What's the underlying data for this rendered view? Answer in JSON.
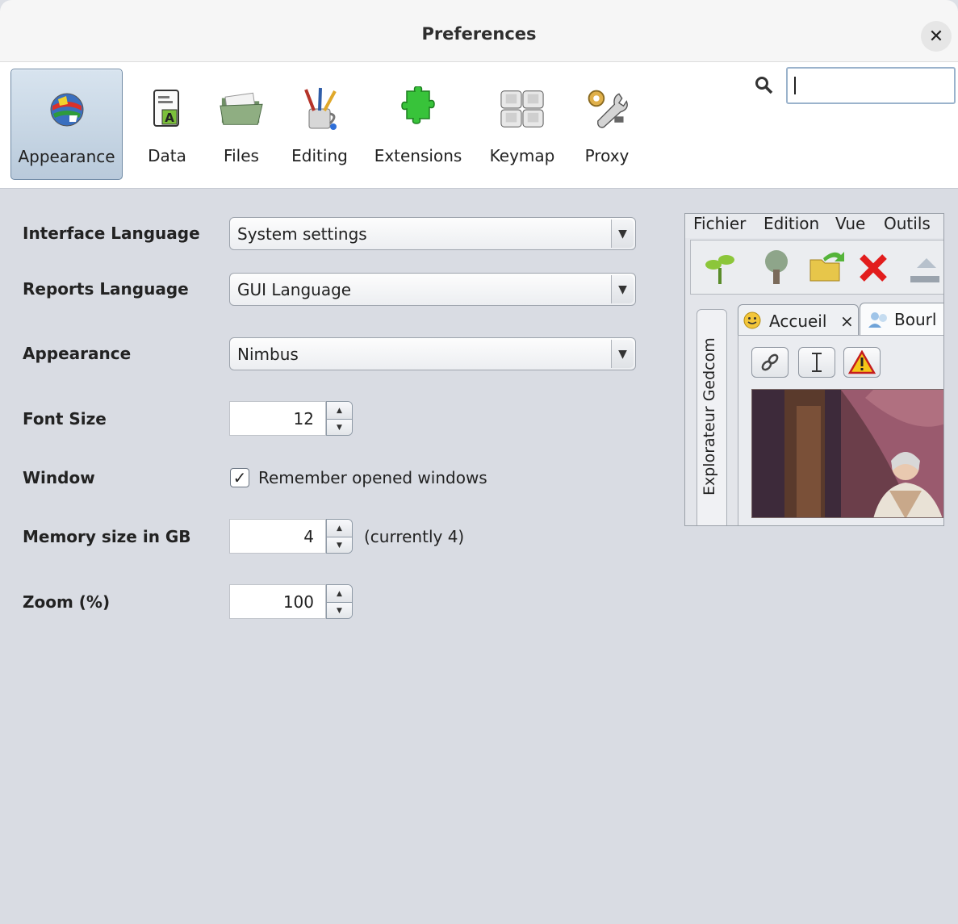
{
  "window": {
    "title": "Preferences"
  },
  "toolbar": {
    "tabs": [
      {
        "label": "Appearance",
        "icon": "globe-flags-icon",
        "active": true
      },
      {
        "label": "Data",
        "icon": "data-document-icon",
        "active": false
      },
      {
        "label": "Files",
        "icon": "folder-icon",
        "active": false
      },
      {
        "label": "Editing",
        "icon": "brushes-cup-icon",
        "active": false
      },
      {
        "label": "Extensions",
        "icon": "puzzle-piece-icon",
        "active": false
      },
      {
        "label": "Keymap",
        "icon": "keyboard-keys-icon",
        "active": false
      },
      {
        "label": "Proxy",
        "icon": "gear-wrench-icon",
        "active": false
      }
    ],
    "search": {
      "value": "",
      "icon": "search-icon"
    }
  },
  "form": {
    "interface_language": {
      "label": "Interface Language",
      "value": "System settings"
    },
    "reports_language": {
      "label": "Reports Language",
      "value": "GUI Language"
    },
    "appearance": {
      "label": "Appearance",
      "value": "Nimbus"
    },
    "font_size": {
      "label": "Font Size",
      "value": "12"
    },
    "window": {
      "label": "Window",
      "checkbox_label": "Remember opened windows",
      "checked": true
    },
    "memory": {
      "label": "Memory size in GB",
      "value": "4",
      "note": "(currently 4)"
    },
    "zoom": {
      "label": "Zoom (%)",
      "value": "100"
    }
  },
  "preview": {
    "menus": [
      "Fichier",
      "Edition",
      "Vue",
      "Outils"
    ],
    "side_tab": "Explorateur Gedcom",
    "tabs": [
      {
        "label": "Accueil",
        "close": "×"
      },
      {
        "label": "Bourl"
      }
    ]
  },
  "colors": {
    "active_tab_bg": "#c9d8e6",
    "panel_bg": "#d9dce3",
    "accent_border": "#9bb3cc"
  }
}
